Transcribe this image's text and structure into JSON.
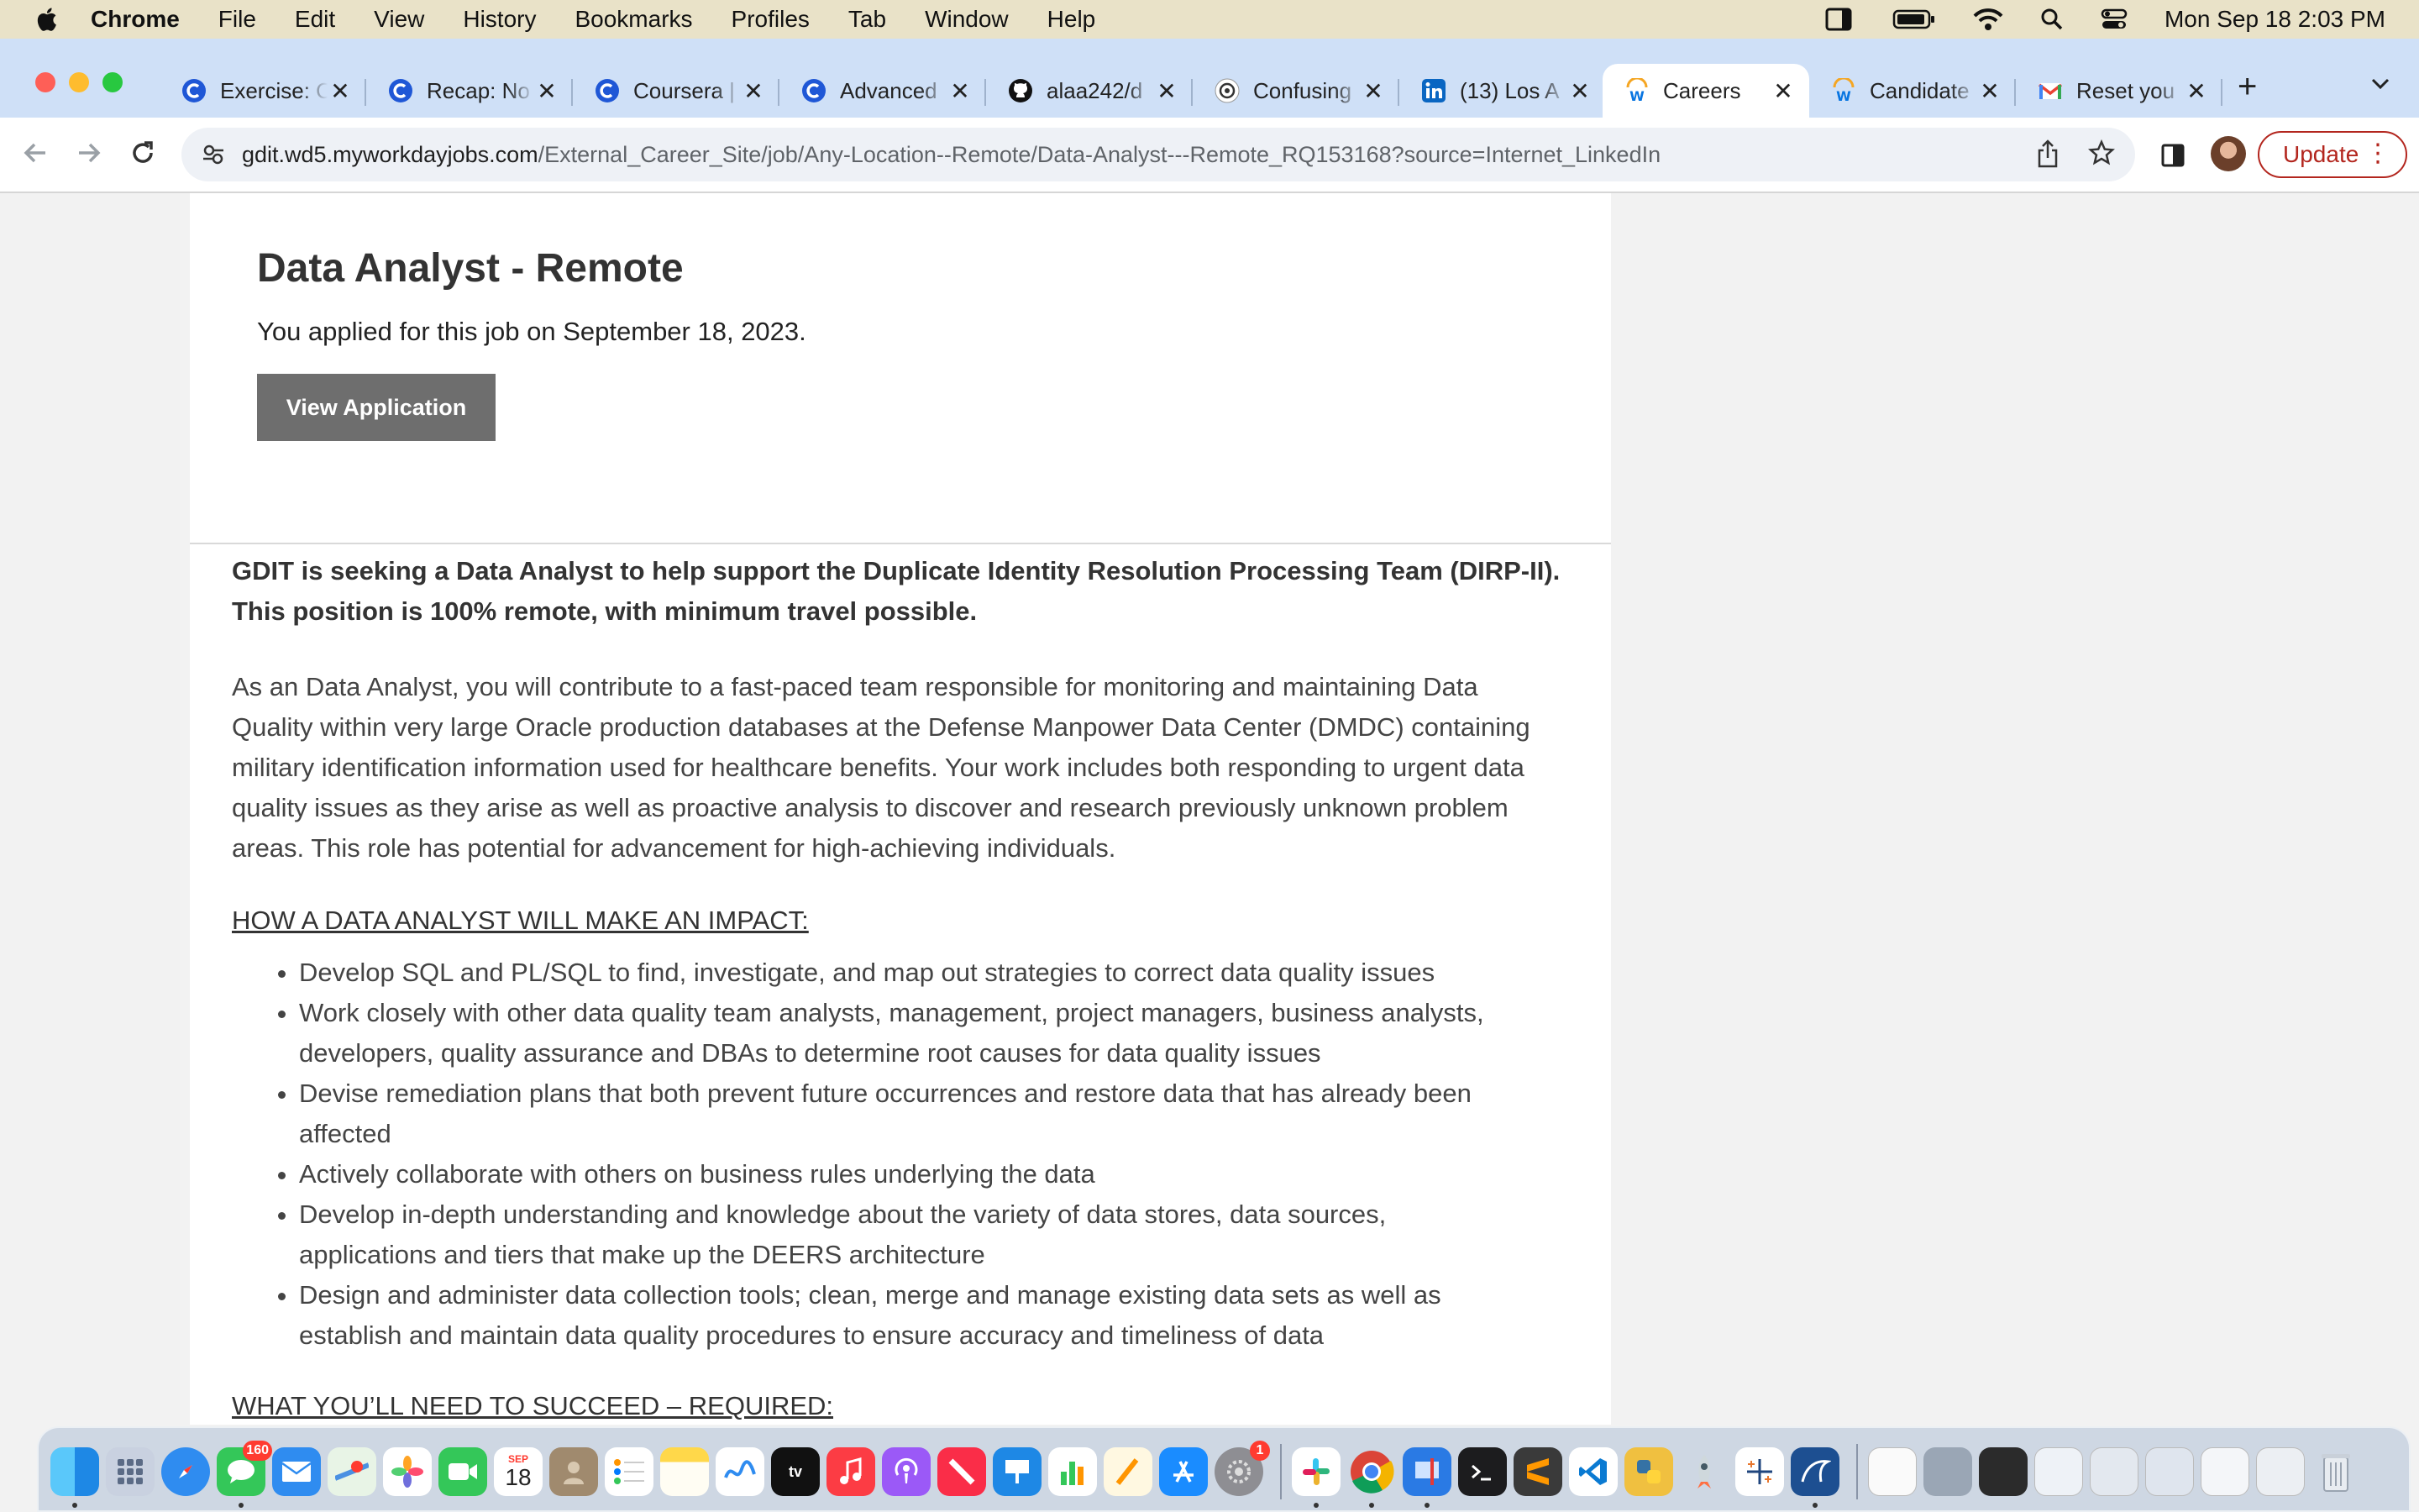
{
  "menubar": {
    "app_name": "Chrome",
    "items": [
      "File",
      "Edit",
      "View",
      "History",
      "Bookmarks",
      "Profiles",
      "Tab",
      "Window",
      "Help"
    ],
    "clock": "Mon Sep 18  2:03 PM"
  },
  "tabs": [
    {
      "title": "Exercise: C",
      "icon": "coursera-icon"
    },
    {
      "title": "Recap: No",
      "icon": "coursera-icon"
    },
    {
      "title": "Coursera |",
      "icon": "coursera-icon"
    },
    {
      "title": "Advanced",
      "icon": "coursera-icon"
    },
    {
      "title": "alaa242/d",
      "icon": "github-icon"
    },
    {
      "title": "Confusing",
      "icon": "chatgpt-icon"
    },
    {
      "title": "(13) Los A",
      "icon": "linkedin-icon"
    },
    {
      "title": "Careers",
      "icon": "workday-icon",
      "active": true
    },
    {
      "title": "Candidate",
      "icon": "workday-icon"
    },
    {
      "title": "Reset you",
      "icon": "gmail-icon"
    }
  ],
  "address_bar": {
    "host": "gdit.wd5.myworkdayjobs.com",
    "path": "/External_Career_Site/job/Any-Location--Remote/Data-Analyst---Remote_RQ153168?source=Internet_LinkedIn"
  },
  "update_label": "Update",
  "job": {
    "title": "Data Analyst - Remote",
    "applied_note": "You applied for this job on September 18, 2023.",
    "view_application_label": "View Application",
    "intro": "GDIT is seeking a Data Analyst to help support the Duplicate Identity Resolution Processing Team (DIRP-II). This position is 100% remote, with minimum travel possible.",
    "body": "As an Data Analyst, you will contribute to a fast-paced team responsible for monitoring and maintaining Data Quality within very large Oracle production databases at the Defense Manpower Data Center (DMDC) containing military identification information used for healthcare benefits. Your work includes both responding to urgent data quality issues as they arise as well as proactive analysis to discover and research previously unknown problem areas. This role has potential for advancement for high-achieving individuals.",
    "impact_heading": "HOW A DATA ANALYST WILL MAKE AN IMPACT:",
    "impact_items": [
      "Develop SQL and PL/SQL to find, investigate, and map out strategies to correct data quality issues",
      "Work closely with other data quality team analysts, management, project managers, business analysts, developers, quality assurance and DBAs to determine root causes for data quality issues",
      "Devise remediation plans that both prevent future occurrences and restore data that has already been affected",
      "Actively collaborate with others on business rules underlying the data",
      "Develop in-depth understanding and knowledge about the variety of data stores, data sources, applications and tiers that make up the DEERS architecture",
      "Design and administer data collection tools; clean, merge and manage existing data sets as well as establish and maintain data quality procedures to ensure accuracy and timeliness of data"
    ],
    "required_heading": "WHAT YOU’LL NEED TO SUCCEED – REQUIRED:"
  },
  "dock": {
    "messages_badge": "160",
    "calendar_month": "SEP",
    "calendar_day": "18",
    "settings_badge": "1"
  },
  "colors": {
    "menubar": "#e9e2c8",
    "tabstrip": "#cfe0f7",
    "button_gray": "#6e6e6e",
    "update_red": "#b3261e"
  }
}
